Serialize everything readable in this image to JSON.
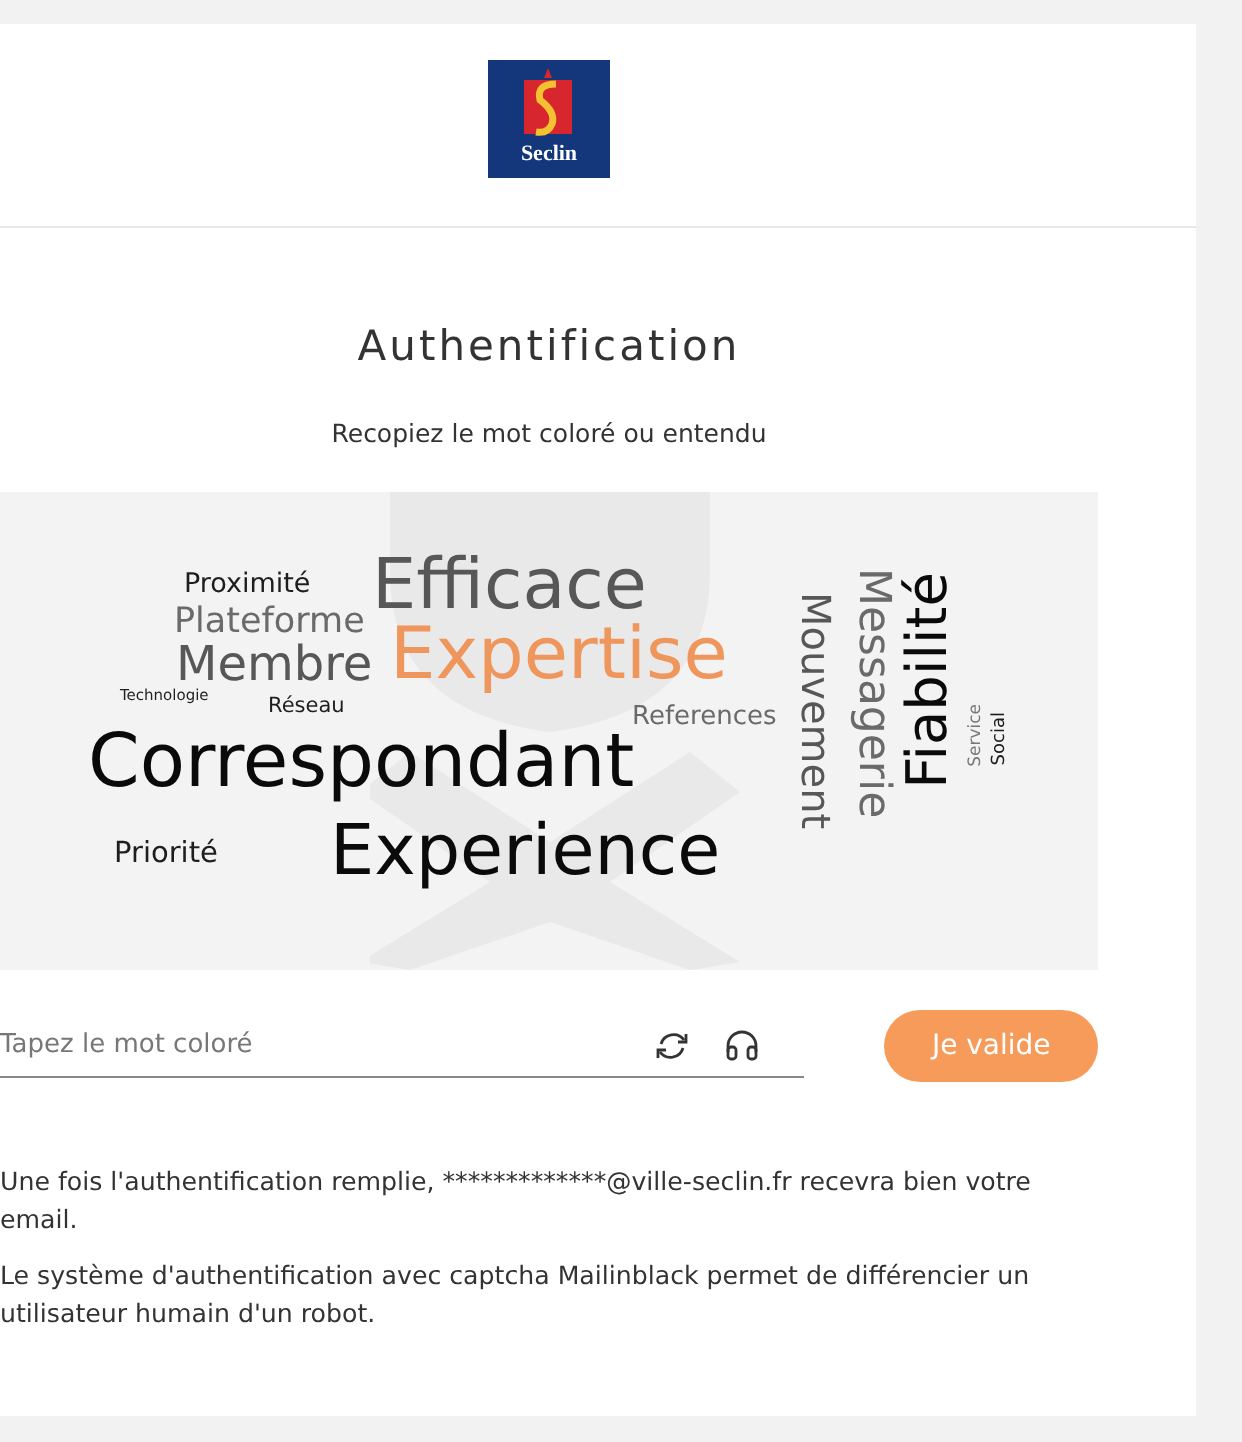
{
  "header": {
    "logo_text": "Seclin"
  },
  "title": "Authentification",
  "instruction": "Recopiez le mot coloré ou entendu",
  "captcha": {
    "words": [
      {
        "text": "Proximité",
        "color": "#1e1e1e",
        "kind": "horizontal"
      },
      {
        "text": "Efficace",
        "color": "#575757",
        "kind": "horizontal"
      },
      {
        "text": "Plateforme",
        "color": "#6a6a6a",
        "kind": "horizontal"
      },
      {
        "text": "Membre",
        "color": "#575757",
        "kind": "horizontal"
      },
      {
        "text": "Expertise",
        "color": "#ef965c",
        "kind": "horizontal"
      },
      {
        "text": "Technologie",
        "color": "#1e1e1e",
        "kind": "horizontal"
      },
      {
        "text": "Réseau",
        "color": "#1e1e1e",
        "kind": "horizontal"
      },
      {
        "text": "References",
        "color": "#6a6a6a",
        "kind": "horizontal"
      },
      {
        "text": "Correspondant",
        "color": "#0a0a0a",
        "kind": "horizontal"
      },
      {
        "text": "Priorité",
        "color": "#1e1e1e",
        "kind": "horizontal"
      },
      {
        "text": "Experience",
        "color": "#0a0a0a",
        "kind": "horizontal"
      },
      {
        "text": "Mouvement",
        "color": "#575757",
        "kind": "down"
      },
      {
        "text": "Messagerie",
        "color": "#6a6a6a",
        "kind": "down"
      },
      {
        "text": "Fiabilité",
        "color": "#0a0a0a",
        "kind": "up"
      },
      {
        "text": "Service",
        "color": "#777777",
        "kind": "up"
      },
      {
        "text": "Social",
        "color": "#1e1e1e",
        "kind": "up"
      }
    ]
  },
  "answer": {
    "placeholder": "Tapez le mot coloré"
  },
  "submit_button": "Je valide",
  "notes": [
    "Une fois l'authentification remplie, *************@ville-seclin.fr recevra bien votre email.",
    "Le système d'authentification avec captcha Mailinblack permet de différencier un utilisateur humain d'un robot."
  ]
}
